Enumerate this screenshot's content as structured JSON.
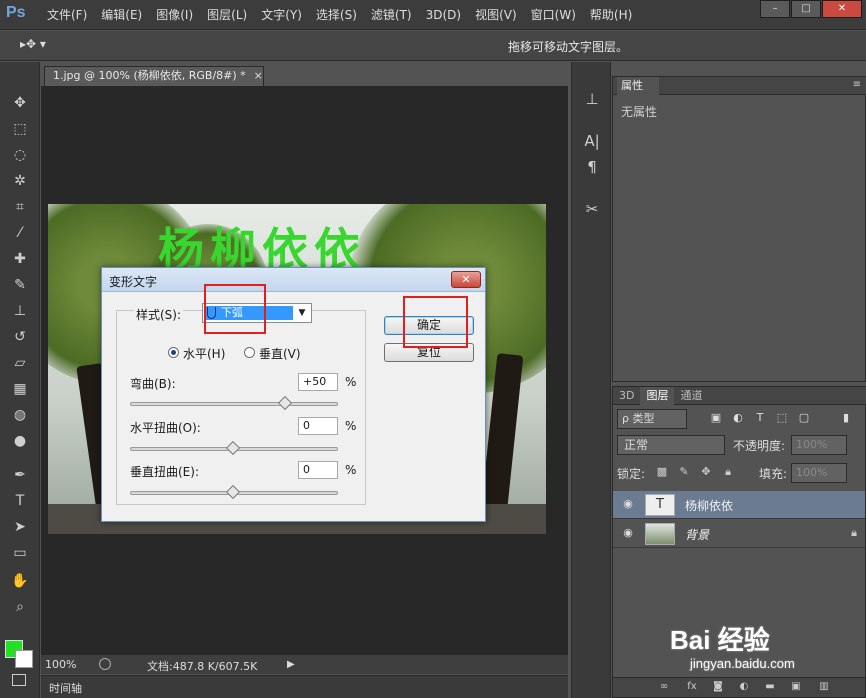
{
  "app": {
    "logo": "Ps",
    "menu": [
      "文件(F)",
      "编辑(E)",
      "图像(I)",
      "图层(L)",
      "文字(Y)",
      "选择(S)",
      "滤镜(T)",
      "3D(D)",
      "视图(V)",
      "窗口(W)",
      "帮助(H)"
    ],
    "window_buttons": [
      "–",
      "□",
      "✕"
    ]
  },
  "options_bar": {
    "tool_preset": "▸✥ ▾",
    "hint": "拖移可移动文字图层。"
  },
  "document": {
    "tab_title": "1.jpg @ 100% (杨柳依依, RGB/8#) *",
    "tab_close": "×",
    "canvas_text": "杨柳依依",
    "zoom": "100%",
    "doc_info": "文档:487.8 K/607.5K",
    "timeline": "时间轴"
  },
  "colors": {
    "foreground": "#22e022",
    "background": "#ffffff",
    "selected_layer": "#6b7b91",
    "highlight": "#e02020"
  },
  "properties_panel": {
    "tab": "属性",
    "body": "无属性"
  },
  "layers_panel": {
    "tabs": [
      "3D",
      "图层",
      "通道"
    ],
    "active_tab": "图层",
    "filter": "ρ 类型",
    "blend_mode": "正常",
    "opacity_label": "不透明度:",
    "opacity_value": "100%",
    "lock_label": "锁定:",
    "fill_label": "填充:",
    "fill_value": "100%",
    "layers": [
      {
        "name": "杨柳依依",
        "type": "text",
        "thumb": "T",
        "selected": true
      },
      {
        "name": "背景",
        "type": "image",
        "thumb": "",
        "selected": false,
        "locked": true
      }
    ],
    "footer_icons": [
      "link-icon",
      "fx-icon",
      "mask-icon",
      "adjustment-icon",
      "folder-icon",
      "new-layer-icon",
      "trash-icon"
    ]
  },
  "warp_dialog": {
    "title": "变形文字",
    "close": "✕",
    "style_label": "样式(S):",
    "style_value": "下弧",
    "horizontal_label": "水平(H)",
    "vertical_label": "垂直(V)",
    "orientation": "horizontal",
    "bend_label": "弯曲(B):",
    "bend_value": "+50",
    "bend_fraction": 0.75,
    "hdistort_label": "水平扭曲(O):",
    "hdistort_value": "0",
    "hdistort_fraction": 0.5,
    "vdistort_label": "垂直扭曲(E):",
    "vdistort_value": "0",
    "vdistort_fraction": 0.5,
    "percent": "%",
    "ok_label": "确定",
    "reset_label": "复位"
  },
  "watermark": {
    "logo": "Bai 经验",
    "url": "jingyan.baidu.com"
  }
}
